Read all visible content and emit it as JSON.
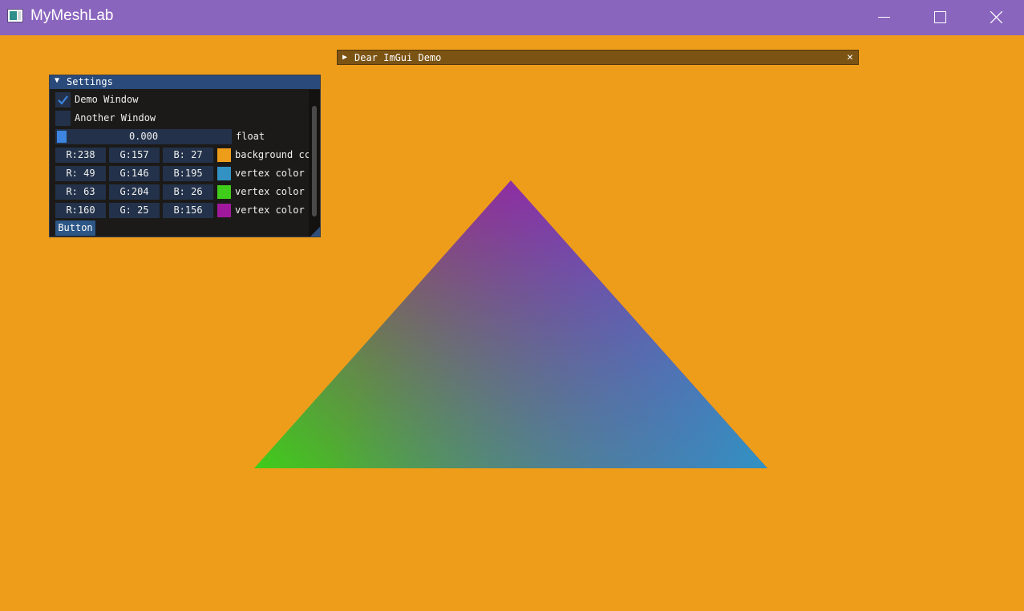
{
  "window": {
    "title": "MyMeshLab",
    "background_color": "#EE9D1B"
  },
  "titlebar_buttons": {
    "minimize": "minimize-icon",
    "maximize": "maximize-icon",
    "close": "close-icon"
  },
  "demo_window": {
    "title": "Dear ImGui Demo",
    "collapsed": true
  },
  "settings": {
    "title": "Settings",
    "checkboxes": [
      {
        "label": "Demo Window",
        "checked": true
      },
      {
        "label": "Another Window",
        "checked": false
      }
    ],
    "slider": {
      "value": "0.000",
      "label": "float",
      "fraction": 0.0
    },
    "colors": [
      {
        "r": "R:238",
        "g": "G:157",
        "b": "B: 27",
        "hex": "#EE9D1B",
        "label": "background cc"
      },
      {
        "r": "R: 49",
        "g": "G:146",
        "b": "B:195",
        "hex": "#3192C3",
        "label": "vertex color"
      },
      {
        "r": "R: 63",
        "g": "G:204",
        "b": "B: 26",
        "hex": "#3FCC1A",
        "label": "vertex color"
      },
      {
        "r": "R:160",
        "g": "G: 25",
        "b": "B:156",
        "hex": "#A0199C",
        "label": "vertex color"
      }
    ],
    "button_label": "Button"
  },
  "triangle": {
    "top_color": "#A0199C",
    "left_color": "#3FCC1A",
    "right_color": "#3192C3"
  }
}
